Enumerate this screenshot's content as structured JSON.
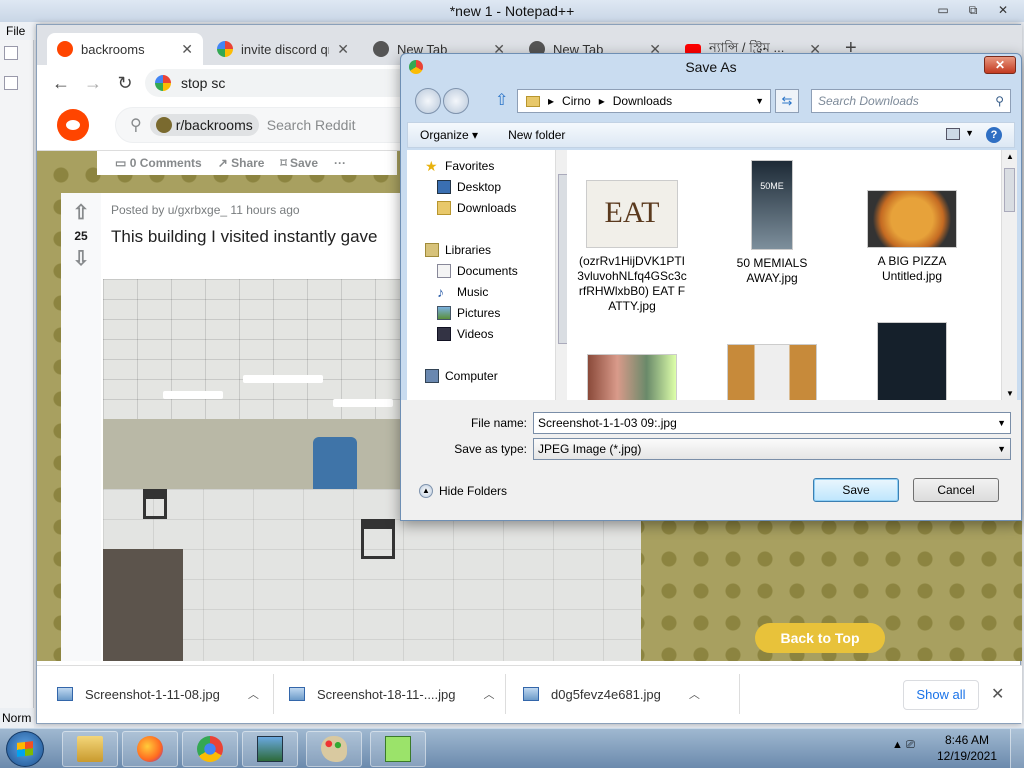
{
  "notepad": {
    "title": "*new 1 - Notepad++",
    "menu_file": "File",
    "ctrl_min": "▭",
    "ctrl_max": "⧉",
    "ctrl_close": "✕",
    "status_left": "Norm"
  },
  "chrome": {
    "tabs": [
      {
        "label": "backrooms",
        "icon": "reddit-icon",
        "active": true
      },
      {
        "label": "invite discord qr",
        "icon": "google-icon"
      },
      {
        "label": "New Tab",
        "icon": "chrome-icon"
      },
      {
        "label": "New Tab",
        "icon": "chrome-icon"
      },
      {
        "label": "ন্যান্সি / স্ট্রিম ...",
        "icon": "youtube-icon"
      }
    ],
    "tab_close": "✕",
    "new_tab": "+",
    "omnibox_text": "stop sc",
    "win_min": "—",
    "win_max": "⧉",
    "win_close": "✕"
  },
  "reddit": {
    "subreddit_chip": "r/backrooms",
    "search_placeholder": "Search Reddit",
    "comments": "0 Comments",
    "share": "Share",
    "save": "Save",
    "more": "···",
    "vote_count": "25",
    "posted_by": "Posted by u/gxrbxge_ 11 hours ago",
    "post_title": "This building I visited instantly gave",
    "back_to_top": "Back to Top"
  },
  "downloads": {
    "items": [
      {
        "name": "Screenshot-1-11-08.jpg"
      },
      {
        "name": "Screenshot-18-11-....jpg"
      },
      {
        "name": "d0g5fevz4e681.jpg"
      }
    ],
    "show_all": "Show all",
    "close": "✕"
  },
  "save_dialog": {
    "title": "Save As",
    "close": "✕",
    "breadcrumb": [
      "Cirno",
      "Downloads"
    ],
    "search_placeholder": "Search Downloads",
    "organize": "Organize ▾",
    "new_folder": "New folder",
    "help": "?",
    "nav": {
      "favorites": "Favorites",
      "desktop": "Desktop",
      "downloads": "Downloads",
      "libraries": "Libraries",
      "documents": "Documents",
      "music": "Music",
      "pictures": "Pictures",
      "videos": "Videos",
      "computer": "Computer"
    },
    "files": [
      {
        "name": "(ozrRv1HijDVK1PTI3vluvohNLfq4GSc3crfRHWlxbB0) EAT FATTY.jpg"
      },
      {
        "name": "50 MEMIALS AWAY.jpg"
      },
      {
        "name": "A BIG PIZZA Untitled.jpg"
      }
    ],
    "file_name_label": "File name:",
    "file_name_value": "Screenshot-1-1-03 09:.jpg",
    "save_type_label": "Save as type:",
    "save_type_value": "JPEG Image (*.jpg)",
    "hide_folders": "Hide Folders",
    "save_button": "Save",
    "cancel_button": "Cancel"
  },
  "taskbar": {
    "time": "8:46 AM",
    "date": "12/19/2021"
  },
  "colors": {
    "reddit_orange": "#ff4500",
    "chrome_link_blue": "#1a73e8",
    "back_to_top_yellow": "#e8c23a"
  }
}
